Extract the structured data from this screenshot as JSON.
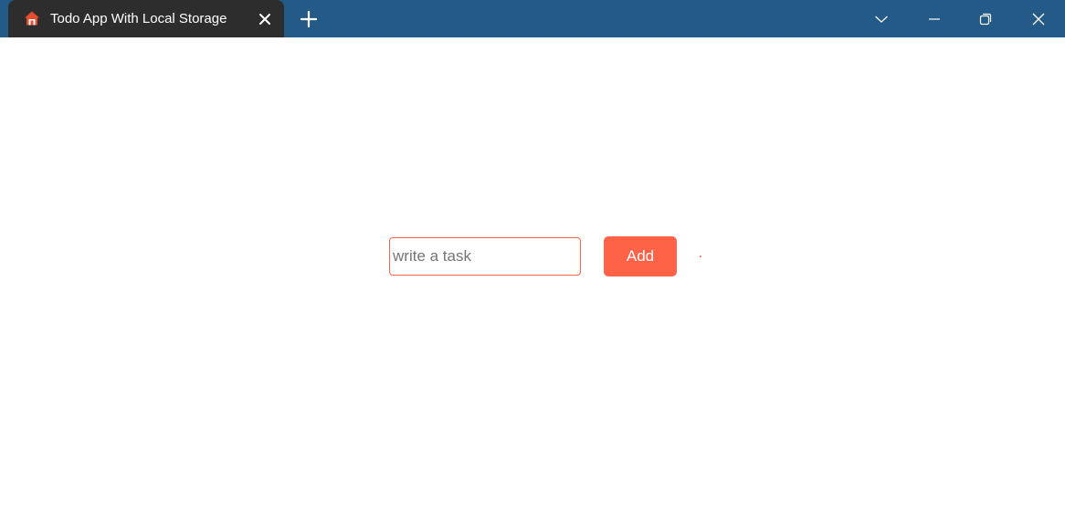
{
  "browser": {
    "tab": {
      "title": "Todo App With Local Storage",
      "favicon": "home-icon"
    },
    "icons": {
      "tab_close": "close-icon",
      "new_tab": "plus-icon",
      "tab_search": "chevron-down-icon",
      "minimize": "minimize-icon",
      "restore": "restore-icon",
      "close": "close-icon"
    },
    "colors": {
      "titlebar": "#235a87",
      "active_tab": "#2d2d2d"
    }
  },
  "app": {
    "task_input": {
      "placeholder": "write a task",
      "value": ""
    },
    "add_button": {
      "label": "Add"
    },
    "colors": {
      "accent": "#ff6347"
    }
  }
}
